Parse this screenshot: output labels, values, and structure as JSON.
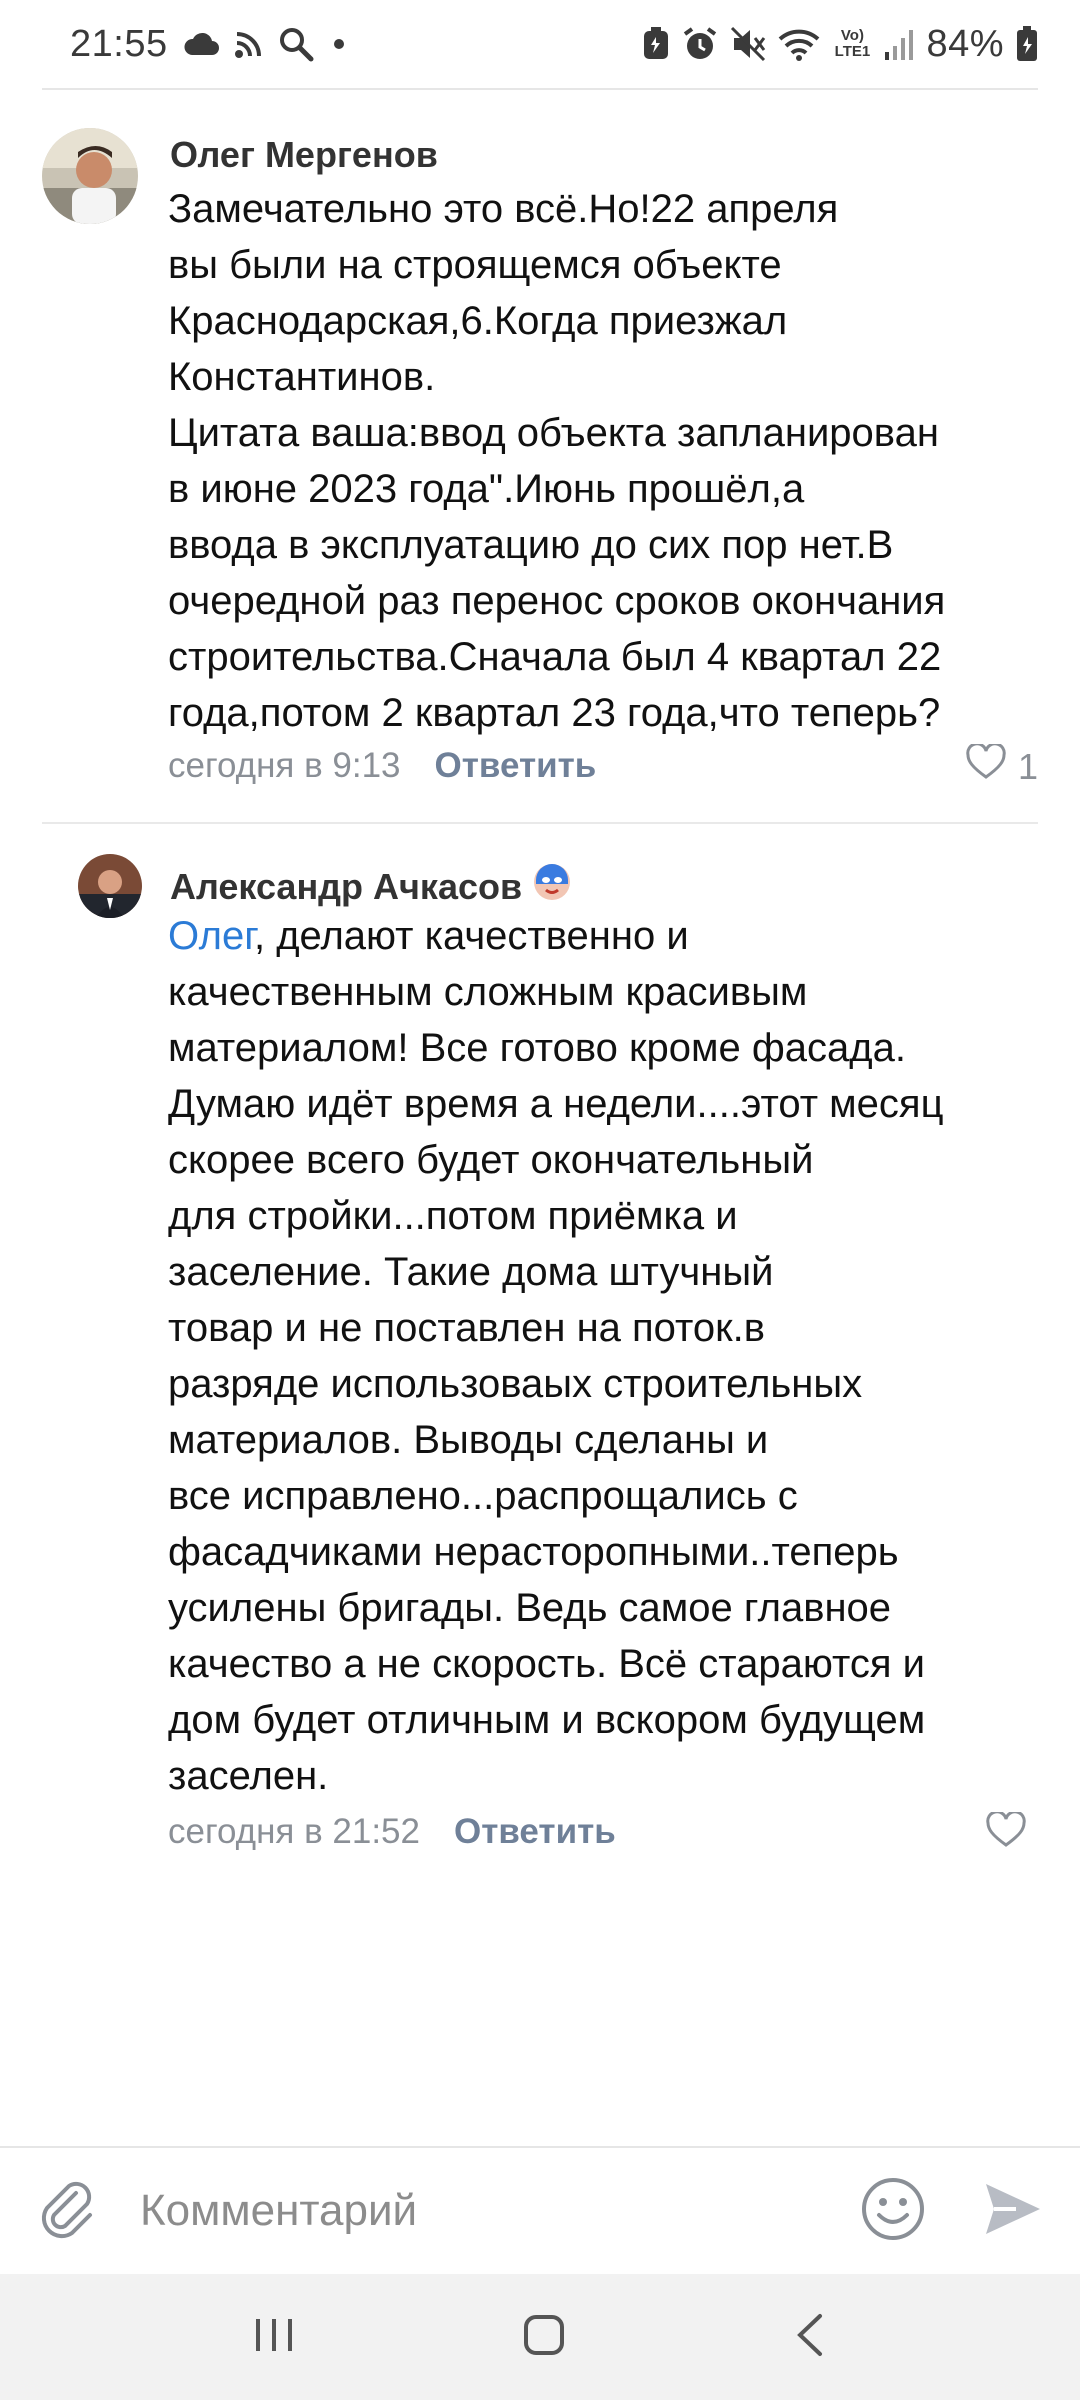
{
  "status_bar": {
    "time": "21:55",
    "battery_percent": "84%",
    "network_label": "Vo) LTE1",
    "icons": [
      "cloud-icon",
      "cast-icon",
      "search-icon",
      "dot-icon",
      "battery-saver-icon",
      "alarm-icon",
      "mute-icon",
      "wifi-icon",
      "signal-icon",
      "battery-icon"
    ]
  },
  "comments": [
    {
      "author": "Олег Мергенов",
      "text": "Замечательно это всё.Но!22 апреля\nвы были на строящемся объекте\nКраснодарская,6.Когда приезжал\nКонстантинов.\nЦитата ваша:ввод объекта запланирован\nв июне 2023 года\".Июнь прошёл,а\nввода в эксплуатацию до сих пор нет.В\nочередной раз перенос сроков окончания\nстроительства.Сначала был 4 квартал 22\nгода,потом 2 квартал 23 года,что теперь?",
      "time": "сегодня в 9:13",
      "reply_label": "Ответить",
      "likes": "1"
    },
    {
      "author": "Александр Ачкасов",
      "mention": "Олег",
      "text": ", делают качественно и\nкачественным сложным красивым\nматериалом! Все готово кроме фасада.\nДумаю идёт время а недели....этот месяц\nскорее всего будет окончательный\nдля стройки...потом приёмка и\nзаселение. Такие дома штучный\nтовар и не поставлен на поток.в\nразряде использоваых строительных\nматериалов. Выводы сделаны и\nвсе исправлено...распрощались с\nфасадчиками нерасторопными..теперь\nусилены бригады. Ведь самое главное\nкачество а не скорость. Всё стараются и\nдом будет отличным и вскором будущем\nзаселен.",
      "time": "сегодня в 21:52",
      "reply_label": "Ответить",
      "likes": ""
    }
  ],
  "composer": {
    "placeholder": "Комментарий"
  },
  "colors": {
    "mention": "#2b7bd6",
    "meta": "#8a8f96",
    "reply": "#6f8098",
    "send": "#b8bcc4"
  }
}
